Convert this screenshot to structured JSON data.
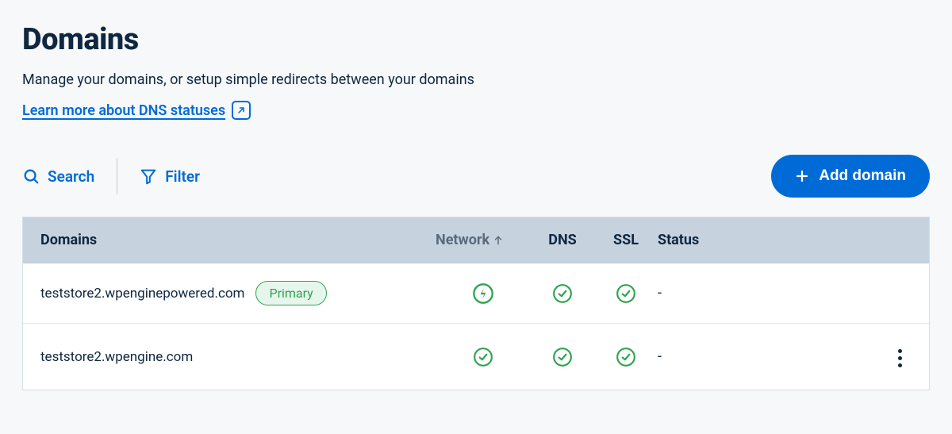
{
  "header": {
    "title": "Domains",
    "subtitle": "Manage your domains, or setup simple redirects between your domains",
    "learn_link": "Learn more about DNS statuses"
  },
  "toolbar": {
    "search_label": "Search",
    "filter_label": "Filter",
    "add_label": "Add domain"
  },
  "table": {
    "columns": {
      "domains": "Domains",
      "network": "Network",
      "dns": "DNS",
      "ssl": "SSL",
      "status": "Status"
    },
    "rows": [
      {
        "domain": "teststore2.wpenginepowered.com",
        "primary_label": "Primary",
        "is_primary": true,
        "network_icon": "bolt-check",
        "dns_icon": "check",
        "ssl_icon": "check",
        "status": "-",
        "has_actions": false
      },
      {
        "domain": "teststore2.wpengine.com",
        "primary_label": "",
        "is_primary": false,
        "network_icon": "check",
        "dns_icon": "check",
        "ssl_icon": "check",
        "status": "-",
        "has_actions": true
      }
    ]
  }
}
